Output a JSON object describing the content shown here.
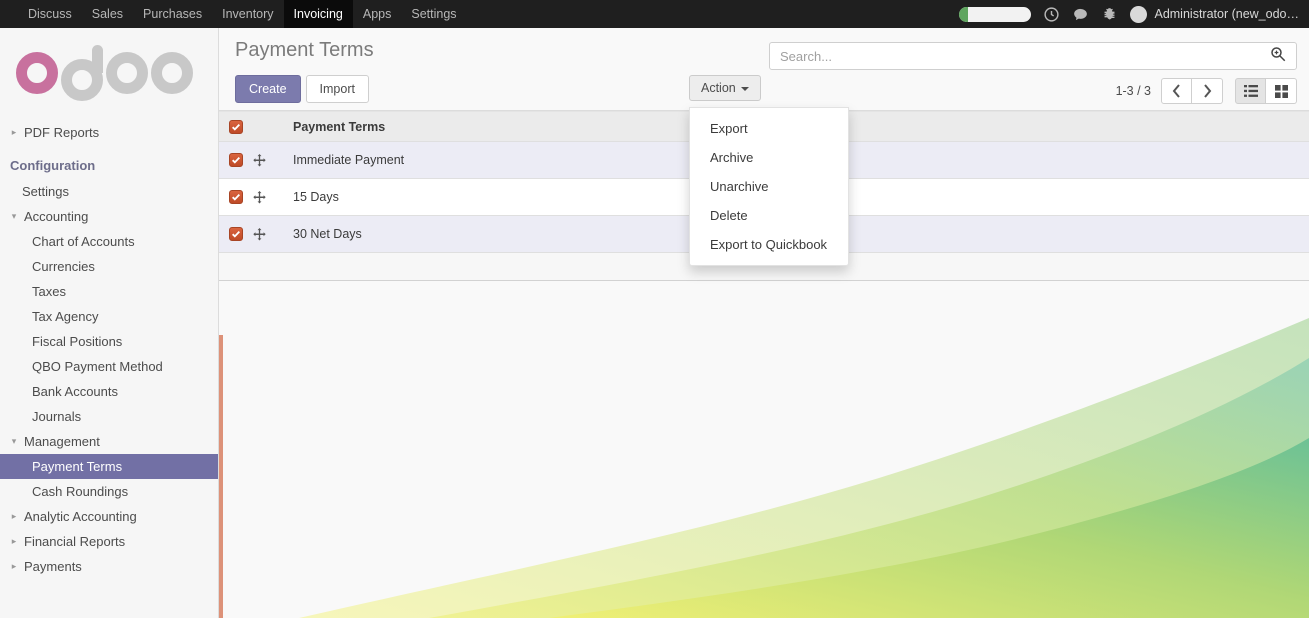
{
  "navbar": {
    "menu_items": [
      {
        "label": "Discuss",
        "active": false
      },
      {
        "label": "Sales",
        "active": false
      },
      {
        "label": "Purchases",
        "active": false
      },
      {
        "label": "Inventory",
        "active": false
      },
      {
        "label": "Invoicing",
        "active": true
      },
      {
        "label": "Apps",
        "active": false
      },
      {
        "label": "Settings",
        "active": false
      }
    ],
    "progress_percent": 12,
    "icons": [
      "clock-icon",
      "chat-icon",
      "bug-icon"
    ],
    "user_name": "Administrator (new_odo…"
  },
  "sidebar": {
    "logo_text": "odoo",
    "items": [
      {
        "label": "PDF Reports",
        "level": 0,
        "caret": "right",
        "selected": false,
        "header": false
      },
      {
        "label": "Configuration",
        "level": 0,
        "caret": "",
        "selected": false,
        "header": true
      },
      {
        "label": "Settings",
        "level": 1,
        "caret": "",
        "selected": false,
        "header": false
      },
      {
        "label": "Accounting",
        "level": 0,
        "caret": "down",
        "selected": false,
        "header": false
      },
      {
        "label": "Chart of Accounts",
        "level": 2,
        "caret": "",
        "selected": false,
        "header": false
      },
      {
        "label": "Currencies",
        "level": 2,
        "caret": "",
        "selected": false,
        "header": false
      },
      {
        "label": "Taxes",
        "level": 2,
        "caret": "",
        "selected": false,
        "header": false
      },
      {
        "label": "Tax Agency",
        "level": 2,
        "caret": "",
        "selected": false,
        "header": false
      },
      {
        "label": "Fiscal Positions",
        "level": 2,
        "caret": "",
        "selected": false,
        "header": false
      },
      {
        "label": "QBO Payment Method",
        "level": 2,
        "caret": "",
        "selected": false,
        "header": false
      },
      {
        "label": "Bank Accounts",
        "level": 2,
        "caret": "",
        "selected": false,
        "header": false
      },
      {
        "label": "Journals",
        "level": 2,
        "caret": "",
        "selected": false,
        "header": false
      },
      {
        "label": "Management",
        "level": 0,
        "caret": "down",
        "selected": false,
        "header": false
      },
      {
        "label": "Payment Terms",
        "level": 2,
        "caret": "",
        "selected": true,
        "header": false
      },
      {
        "label": "Cash Roundings",
        "level": 2,
        "caret": "",
        "selected": false,
        "header": false
      },
      {
        "label": "Analytic Accounting",
        "level": 0,
        "caret": "right",
        "selected": false,
        "header": false
      },
      {
        "label": "Financial Reports",
        "level": 0,
        "caret": "right",
        "selected": false,
        "header": false
      },
      {
        "label": "Payments",
        "level": 0,
        "caret": "right",
        "selected": false,
        "header": false
      }
    ]
  },
  "control_panel": {
    "title": "Payment Terms",
    "create_label": "Create",
    "import_label": "Import",
    "action_label": "Action",
    "action_menu": [
      {
        "label": "Export"
      },
      {
        "label": "Archive"
      },
      {
        "label": "Unarchive"
      },
      {
        "label": "Delete"
      },
      {
        "label": "Export to Quickbook"
      }
    ],
    "search": {
      "value": "",
      "placeholder": "Search..."
    },
    "pager": {
      "count_label": "1-3 / 3",
      "prev_icon": "chevron-left-icon",
      "next_icon": "chevron-right-icon"
    },
    "views": [
      {
        "name": "list-view",
        "active": true
      },
      {
        "name": "kanban-view",
        "active": false
      }
    ]
  },
  "list": {
    "select_all_checked": true,
    "columns": [
      "Payment Terms"
    ],
    "rows": [
      {
        "name": "Immediate Payment",
        "checked": true,
        "striped": true
      },
      {
        "name": "15 Days",
        "checked": true,
        "striped": false
      },
      {
        "name": "30 Net Days",
        "checked": true,
        "striped": true
      }
    ]
  },
  "colors": {
    "accent_purple": "#7c7bad",
    "selected_row": "#ececf5",
    "checkbox_orange": "#c04f29",
    "navbar_dark": "#1f1f1f",
    "sidebar_selected": "#7270a5",
    "coral_bar": "#dd9279",
    "logo_pink": "#c8719e"
  }
}
